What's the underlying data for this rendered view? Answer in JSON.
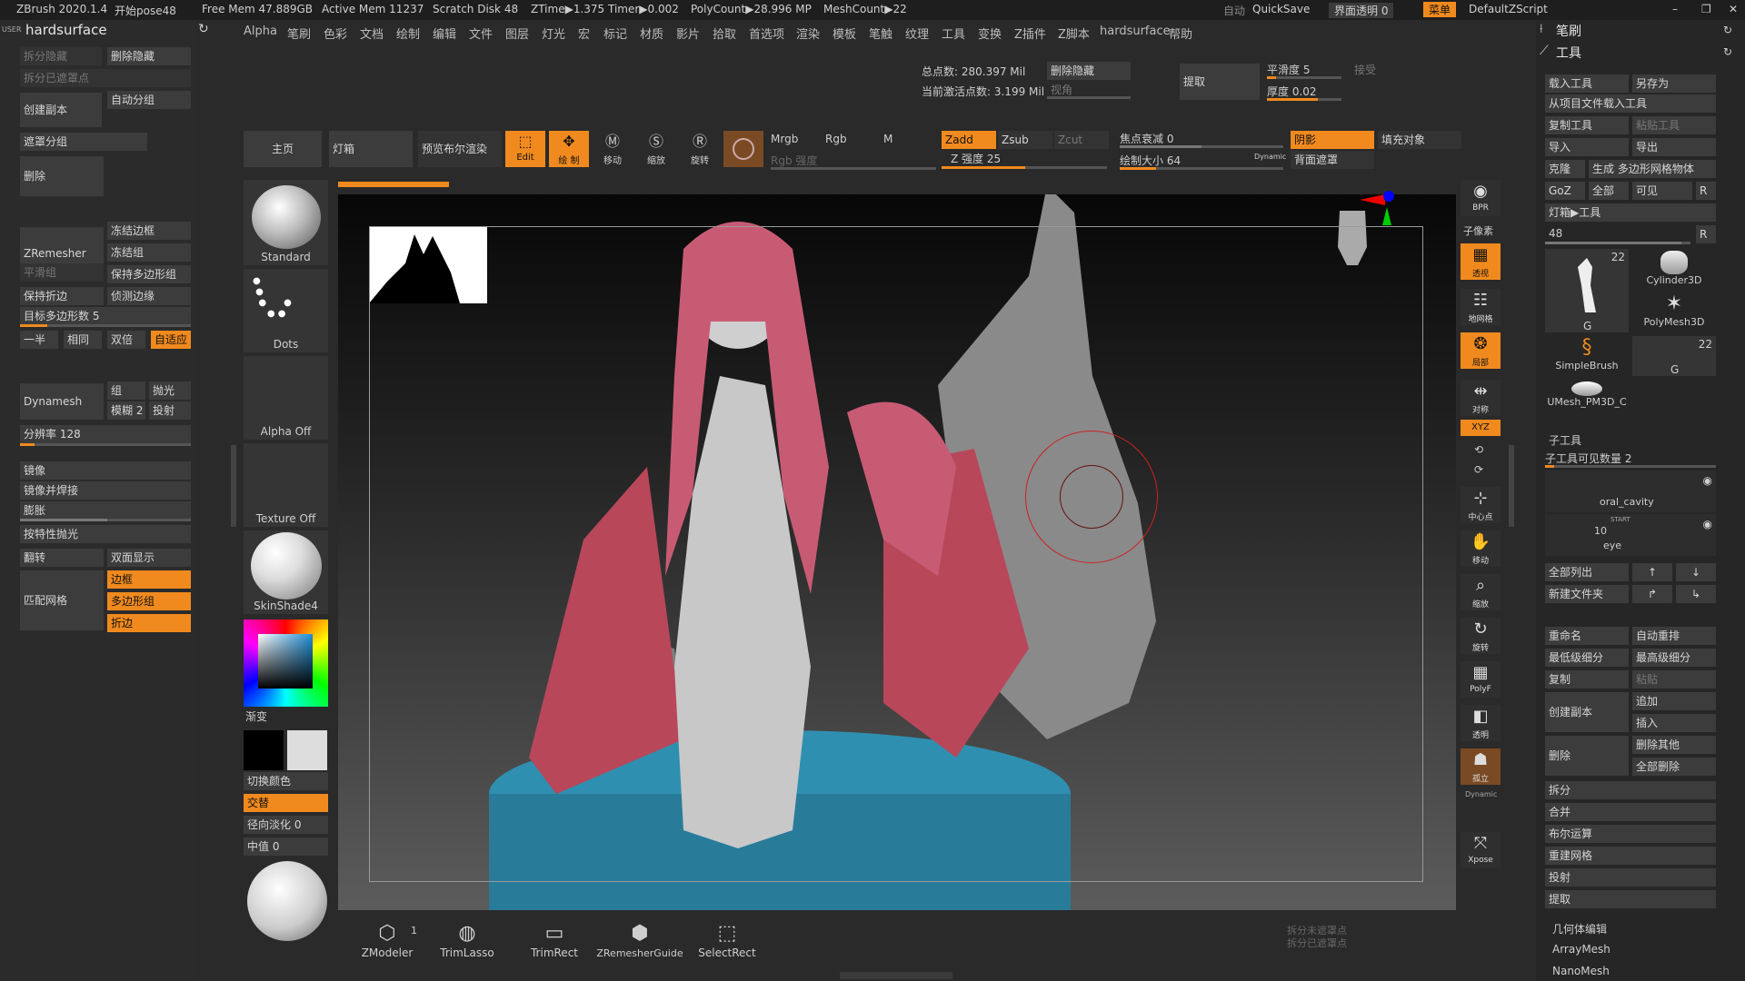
{
  "topbar": {
    "app": "ZBrush 2020.1.4",
    "doc": "开始pose48",
    "free_mem": "Free Mem 47.889GB",
    "active_mem": "Active Mem 11237",
    "scratch": "Scratch Disk 48",
    "ztime": "ZTime▶1.375 Timer▶0.002",
    "polycount": "PolyCount▶28.996 MP",
    "meshcount": "MeshCount▶22",
    "auto": "自动",
    "quicksave": "QuickSave",
    "ui_transparency": "界面透明 0",
    "menu": "菜单",
    "script": "DefaultZScript"
  },
  "menubar": [
    "Alpha",
    "笔刷",
    "色彩",
    "文档",
    "绘制",
    "编辑",
    "文件",
    "图层",
    "灯光",
    "宏",
    "标记",
    "材质",
    "影片",
    "拾取",
    "首选项",
    "渲染",
    "模板",
    "笔触",
    "纹理",
    "工具",
    "变换",
    "Z插件",
    "Z脚本",
    "hardsurface",
    "帮助"
  ],
  "left": {
    "user": "USER",
    "title": "hardsurface",
    "split_hidden": "拆分隐藏",
    "delete_hidden": "删除隐藏",
    "split_masked": "拆分已遮罩点",
    "create_copy": "创建副本",
    "auto_group": "自动分组",
    "mask_group": "遮罩分组",
    "delete": "删除",
    "zremesher": "ZRemesher",
    "freeze_border": "冻结边框",
    "freeze_group": "冻结组",
    "smooth_group": "平滑组",
    "keep_polygroup": "保持多边形组",
    "keep_crease": "保持折边",
    "detect_edge": "侦测边缘",
    "target_poly": "目标多边形数 5",
    "half": "一半",
    "same": "相同",
    "double": "双倍",
    "adaptive": "自适应",
    "dynamesh": "Dynamesh",
    "group": "组",
    "polish": "抛光",
    "blur": "模糊 2",
    "project": "投射",
    "resolution": "分辨率 128",
    "mirror": "镜像",
    "mirror_weld": "镜像并焊接",
    "inflate": "膨胀",
    "polish_by_feature": "按特性抛光",
    "flip": "翻转",
    "double_sided": "双面显示",
    "match_mesh": "匹配网格",
    "border": "边框",
    "polygroups": "多边形组",
    "crease": "折边"
  },
  "brushes": {
    "home": "主页",
    "lightbox": "灯箱",
    "preview_bool": "预览布尔渲染",
    "edit": "Edit",
    "draw": "绘 制",
    "move": "移动",
    "scale": "缩放",
    "rotate": "旋转",
    "standard": "Standard",
    "dots": "Dots",
    "alpha_off": "Alpha Off",
    "texture_off": "Texture Off",
    "material": "SkinShade4",
    "gradient": "渐变",
    "switch_color": "切换颜色",
    "alternate": "交替",
    "radial_fade": "径向淡化 0",
    "median": "中值 0"
  },
  "toolbar": {
    "mrgb": "Mrgb",
    "rgb": "Rgb",
    "m": "M",
    "rgb_intensity": "Rgb 强度",
    "zadd": "Zadd",
    "zsub": "Zsub",
    "zcut": "Zcut",
    "z_intensity": "Z 强度 25",
    "focal_shift": "焦点衰减 0",
    "draw_size": "绘制大小 64",
    "dynamic": "Dynamic",
    "shadow": "阴影",
    "fill_object": "填充对象",
    "back_mask": "背面遮罩",
    "total_points": "总点数: 280.397 Mil",
    "active_points": "当前激活点数: 3.199 Mil",
    "delete_hidden": "删除隐藏",
    "view_angle": "视角",
    "extract": "提取",
    "smooth": "平滑度 5",
    "accept": "接受",
    "thickness": "厚度 0.02"
  },
  "right_icons": [
    "BPR",
    "子像素",
    "透视",
    "地网格",
    "局部",
    "对称",
    "XYZ",
    "中心点",
    "移动",
    "缩放",
    "旋转",
    "PolyF",
    "透明",
    "孤立",
    "Dynamic",
    "Xpose"
  ],
  "right": {
    "brush": "笔刷",
    "tool": "工具",
    "load_tool": "载入工具",
    "save_as": "另存为",
    "load_from_project": "从项目文件载入工具",
    "copy_tool": "复制工具",
    "paste_tool": "粘贴工具",
    "import": "导入",
    "export": "导出",
    "clone": "克隆",
    "make_polymesh": "生成 多边形网格物体",
    "goz": "GoZ",
    "all": "全部",
    "visible": "可见",
    "r": "R",
    "lightbox_tools": "灯箱▶工具",
    "tool_count": "48",
    "thumb_count1": "22",
    "thumb_g": "G",
    "cylinder": "Cylinder3D",
    "polymesh": "PolyMesh3D",
    "simplebrush": "SimpleBrush",
    "thumb_count2": "22",
    "umesh": "UMesh_PM3D_C",
    "subtool": "子工具",
    "subtool_visible": "子工具可见数量 2",
    "oral": "oral_cavity",
    "start": "START",
    "eye_count": "10",
    "eye": "eye",
    "list_all": "全部列出",
    "new_folder": "新建文件夹",
    "rename": "重命名",
    "auto_reorder": "自动重排",
    "lowest_sub": "最低级细分",
    "highest_sub": "最高级细分",
    "duplicate": "复制",
    "paste": "粘贴",
    "create_copy": "创建副本",
    "append": "追加",
    "insert": "插入",
    "delete": "删除",
    "delete_other": "删除其他",
    "delete_all": "全部删除",
    "split": "拆分",
    "merge": "合并",
    "boolean": "布尔运算",
    "remesh": "重建网格",
    "project": "投射",
    "extract": "提取",
    "geometry": "几何体编辑",
    "arraymesh": "ArrayMesh",
    "nanomesh": "NanoMesh"
  },
  "bottom": {
    "zmodeler": "ZModeler",
    "zmodeler_count": "1",
    "trimlasso": "TrimLasso",
    "trimrect": "TrimRect",
    "zremesherguide": "ZRemesherGuide",
    "selectrect": "SelectRect",
    "split_unmasked": "拆分未遮罩点",
    "split_masked": "拆分已遮罩点"
  },
  "colors": {
    "accent": "#f08a1e",
    "water": "#2f8fb0",
    "red": "#c8485a"
  }
}
